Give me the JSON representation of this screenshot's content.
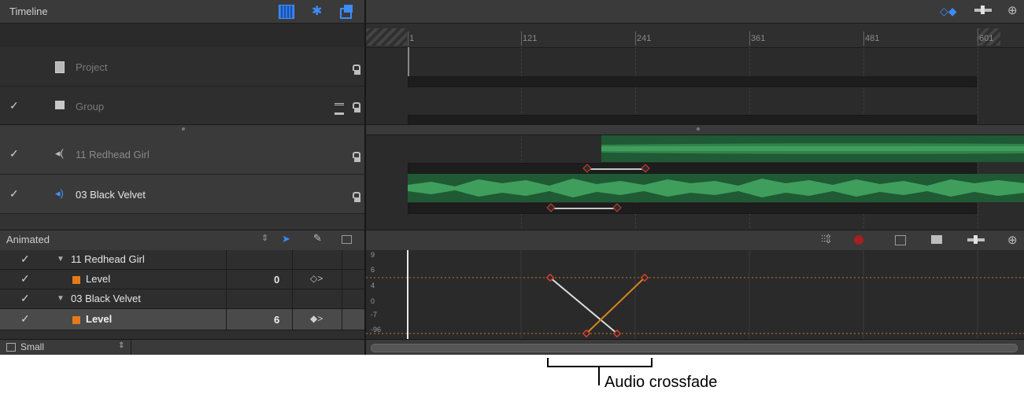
{
  "timeline": {
    "title": "Timeline",
    "ruler_ticks": [
      "1",
      "121",
      "241",
      "361",
      "481",
      "601"
    ]
  },
  "layers": {
    "project": "Project",
    "group": "Group",
    "audio1": "11 Redhead Girl",
    "audio2": "03 Black Velvet"
  },
  "animated": {
    "header": "Animated",
    "rows": [
      {
        "check": "✓",
        "name": "11 Redhead Girl",
        "value": ""
      },
      {
        "check": "✓",
        "name": "Level",
        "value": "0"
      },
      {
        "check": "✓",
        "name": "03 Black Velvet",
        "value": ""
      },
      {
        "check": "✓",
        "name": "Level",
        "value": "6"
      }
    ]
  },
  "footer": {
    "size": "Small"
  },
  "curve_axis": [
    "9",
    "6",
    "4",
    "0",
    "-7",
    "-96"
  ],
  "annotation": "Audio crossfade",
  "colors": {
    "audio_green": "#3f9e5c",
    "keyframe_red": "#d4412c",
    "curve_orange": "#d9831f",
    "accent_blue": "#2e7bf0"
  }
}
